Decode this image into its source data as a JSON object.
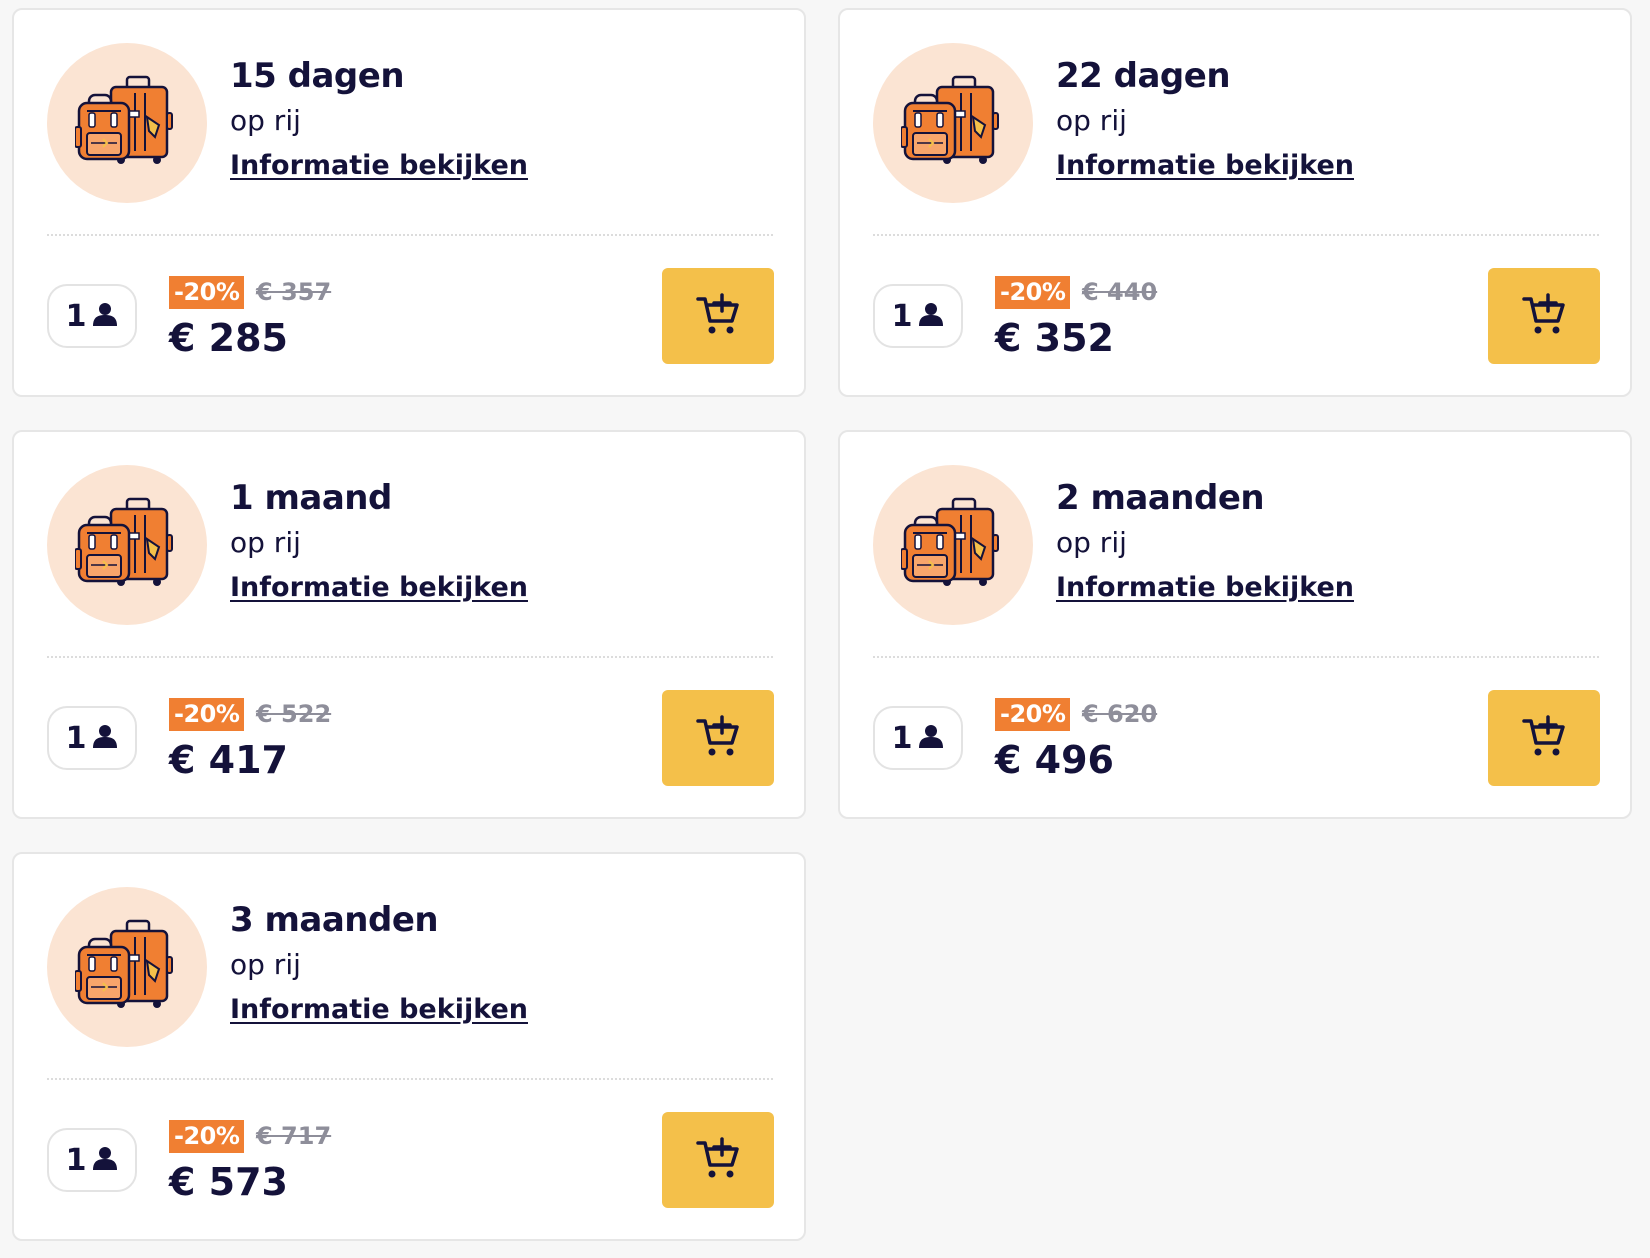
{
  "colors": {
    "page_bg": "#f7f7f7",
    "card_bg": "#ffffff",
    "text": "#14123a",
    "icon_circle": "#fbe4d3",
    "discount_badge": "#f07f32",
    "cart_button": "#f4c04a",
    "old_price": "#8e8e9a"
  },
  "cards": [
    {
      "title": "15 dagen",
      "subtitle": "op rij",
      "link": "Informatie bekijken",
      "icon": "luggage-icon",
      "persons": "1",
      "discount": "-20%",
      "old_price": "€ 357",
      "price": "€ 285",
      "cart_icon": "add-to-cart-icon"
    },
    {
      "title": "22 dagen",
      "subtitle": "op rij",
      "link": "Informatie bekijken",
      "icon": "luggage-icon",
      "persons": "1",
      "discount": "-20%",
      "old_price": "€ 440",
      "price": "€ 352",
      "cart_icon": "add-to-cart-icon"
    },
    {
      "title": "1 maand",
      "subtitle": "op rij",
      "link": "Informatie bekijken",
      "icon": "luggage-icon",
      "persons": "1",
      "discount": "-20%",
      "old_price": "€ 522",
      "price": "€ 417",
      "cart_icon": "add-to-cart-icon"
    },
    {
      "title": "2 maanden",
      "subtitle": "op rij",
      "link": "Informatie bekijken",
      "icon": "luggage-icon",
      "persons": "1",
      "discount": "-20%",
      "old_price": "€ 620",
      "price": "€ 496",
      "cart_icon": "add-to-cart-icon"
    },
    {
      "title": "3 maanden",
      "subtitle": "op rij",
      "link": "Informatie bekijken",
      "icon": "luggage-icon",
      "persons": "1",
      "discount": "-20%",
      "old_price": "€ 717",
      "price": "€ 573",
      "cart_icon": "add-to-cart-icon"
    }
  ]
}
